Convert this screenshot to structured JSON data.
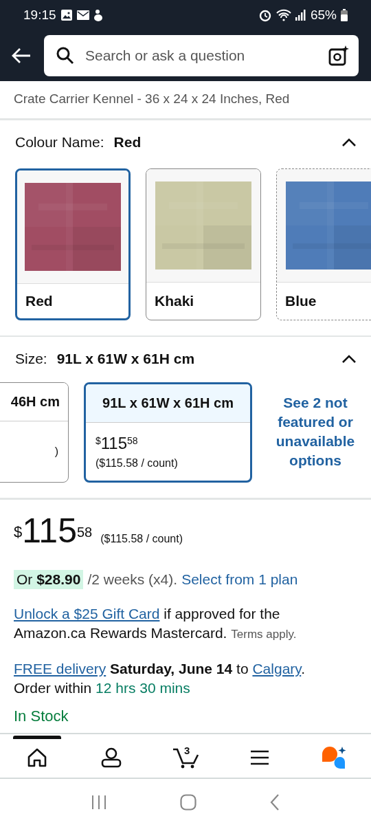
{
  "status_bar": {
    "time": "19:15",
    "battery": "65%"
  },
  "search": {
    "placeholder": "Search or ask a question"
  },
  "product_title": "Crate Carrier Kennel - 36 x 24 x 24 Inches, Red",
  "colour": {
    "label": "Colour Name:",
    "value": "Red",
    "expanded": true,
    "swatches": [
      {
        "name": "Red",
        "color": "#a14d63",
        "selected": true,
        "available": true
      },
      {
        "name": "Khaki",
        "color": "#c9c8a4",
        "selected": false,
        "available": true
      },
      {
        "name": "Blue",
        "color": "#4f7cb8",
        "selected": false,
        "available": false
      }
    ]
  },
  "size": {
    "label": "Size:",
    "value": "91L x 61W x 61H cm",
    "expanded": true,
    "options": [
      {
        "name": "46H cm",
        "count": ")",
        "selected": false
      },
      {
        "name": "91L x 61W x 61H cm",
        "price": {
          "currency": "$",
          "whole": "115",
          "fraction": "58"
        },
        "count": "($115.58 / count)",
        "selected": true
      }
    ],
    "more_link": "See 2 not featured or unavailable options"
  },
  "price": {
    "currency": "$",
    "whole": "115",
    "fraction": "58",
    "per_unit": "($115.58 / count)"
  },
  "installment": {
    "offer": "Or **$28.90**",
    "term": "/2 weeks (x4).",
    "link": "Select from 1 plan"
  },
  "gift_card": {
    "link": "Unlock a $25 Gift Card",
    "text": "if approved for the Amazon.ca Rewards Mastercard.",
    "note": "Terms apply."
  },
  "delivery": {
    "free_link": "FREE delivery",
    "date": "Saturday, June 14",
    "connector": "to",
    "city_link": "Calgary",
    "end": ".",
    "order_label": "Order within",
    "countdown": "12 hrs 30 mins"
  },
  "stock": "In Stock",
  "nav": [
    {
      "kind": "home",
      "selected": true
    },
    {
      "kind": "account",
      "selected": false
    },
    {
      "kind": "cart",
      "count": "3",
      "selected": false
    },
    {
      "kind": "menu",
      "selected": false
    },
    {
      "kind": "assistant",
      "selected": false
    }
  ]
}
